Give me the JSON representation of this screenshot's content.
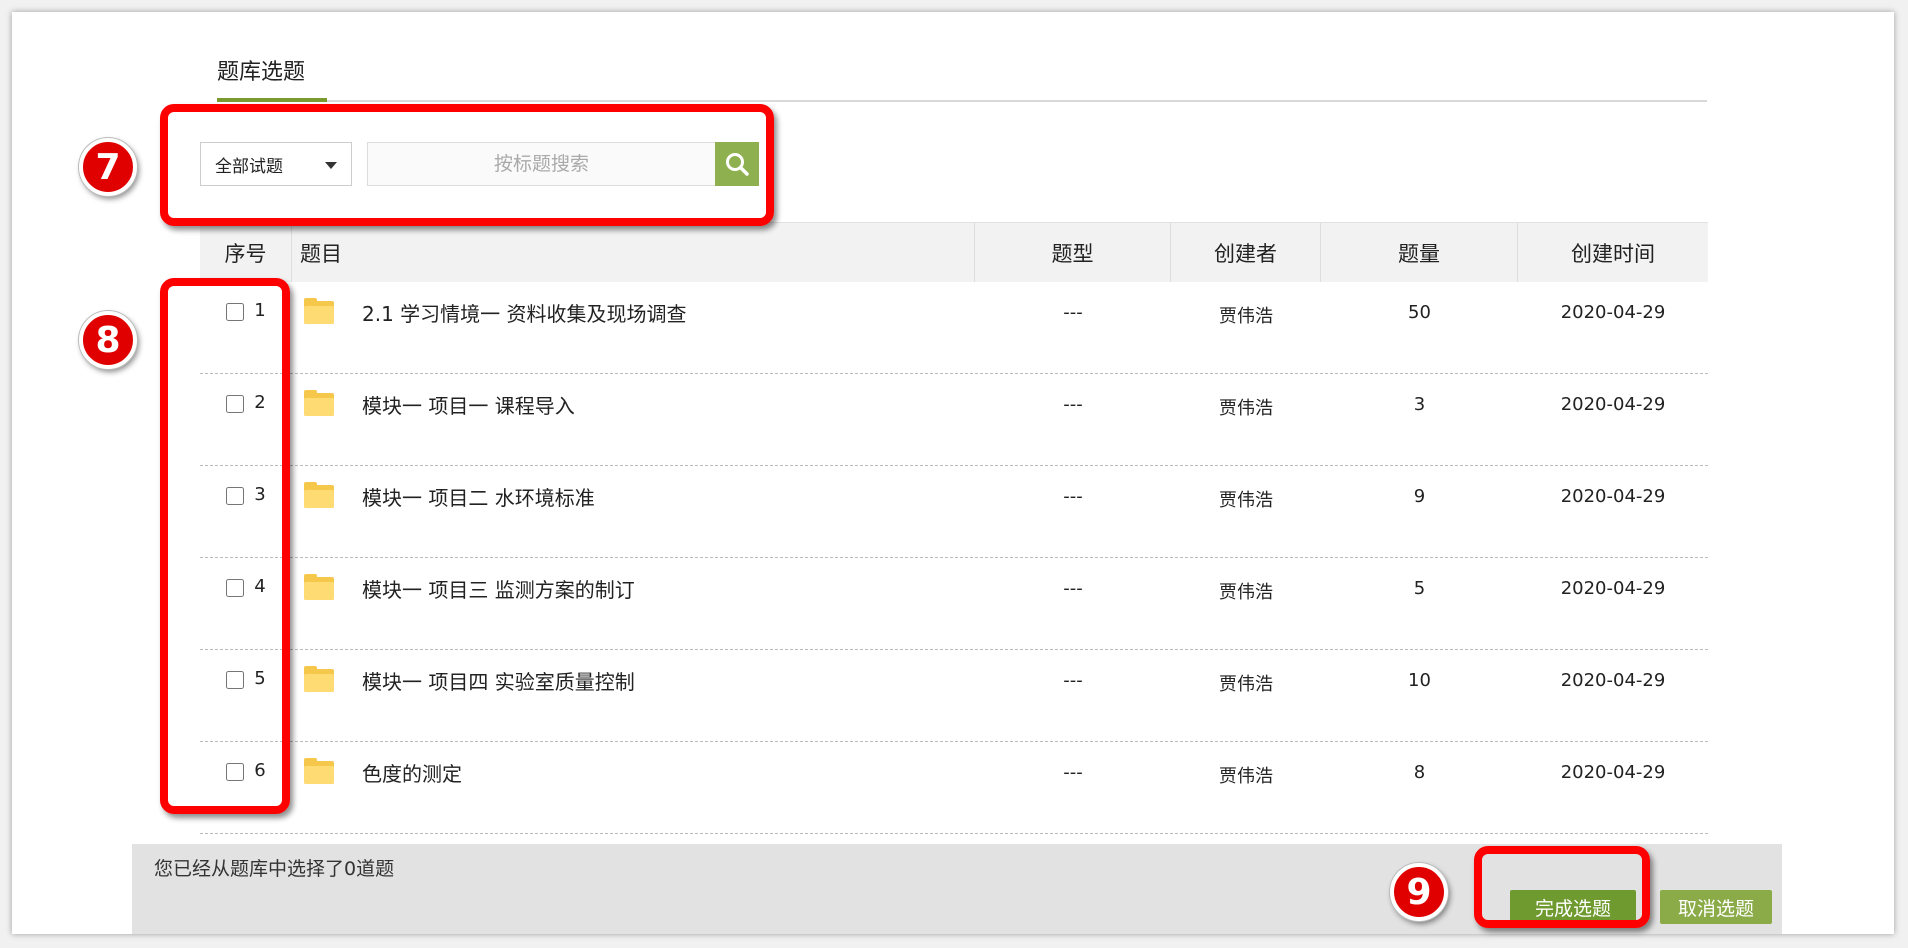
{
  "tab": {
    "title": "题库选题"
  },
  "filter": {
    "type_selected": "全部试题",
    "search_placeholder": "按标题搜索"
  },
  "table": {
    "headers": {
      "no": "序号",
      "title": "题目",
      "type": "题型",
      "creator": "创建者",
      "count": "题量",
      "date": "创建时间"
    },
    "rows": [
      {
        "no": "1",
        "title": "2.1 学习情境一 资料收集及现场调查",
        "type": "---",
        "creator": "贾伟浩",
        "count": "50",
        "date": "2020-04-29"
      },
      {
        "no": "2",
        "title": "模块一 项目一 课程导入",
        "type": "---",
        "creator": "贾伟浩",
        "count": "3",
        "date": "2020-04-29"
      },
      {
        "no": "3",
        "title": "模块一 项目二 水环境标准",
        "type": "---",
        "creator": "贾伟浩",
        "count": "9",
        "date": "2020-04-29"
      },
      {
        "no": "4",
        "title": "模块一 项目三 监测方案的制订",
        "type": "---",
        "creator": "贾伟浩",
        "count": "5",
        "date": "2020-04-29"
      },
      {
        "no": "5",
        "title": "模块一 项目四 实验室质量控制",
        "type": "---",
        "creator": "贾伟浩",
        "count": "10",
        "date": "2020-04-29"
      },
      {
        "no": "6",
        "title": "色度的测定",
        "type": "---",
        "creator": "贾伟浩",
        "count": "8",
        "date": "2020-04-29"
      }
    ]
  },
  "footer": {
    "status": "您已经从题库中选择了0道题",
    "confirm_label": "完成选题",
    "cancel_label": "取消选题"
  },
  "annotations": [
    "7",
    "8",
    "9"
  ],
  "colors": {
    "accent_green": "#6f9a2f",
    "search_button": "#8fb04f",
    "highlight_red": "#ff0000"
  }
}
